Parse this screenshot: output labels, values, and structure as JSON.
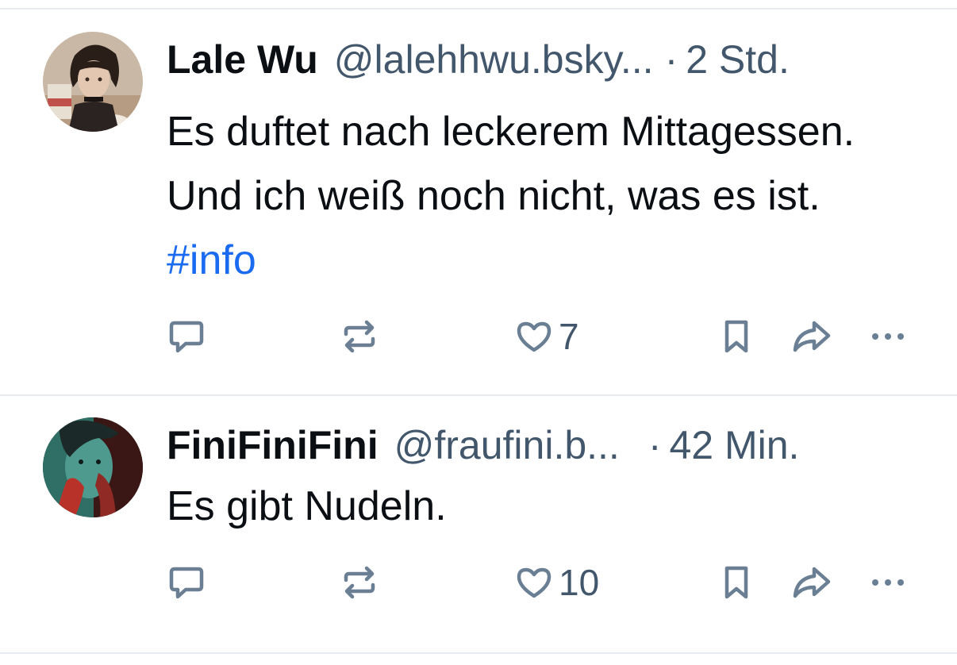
{
  "posts": [
    {
      "display_name": "Lale Wu",
      "handle": "@lalehhwu.bsky...",
      "separator": "·",
      "time": "2 Std.",
      "text": "Es duftet nach leckerem Mittagessen. Und ich weiß noch nicht, was es ist.",
      "hashtag": "#info",
      "like_count": "7",
      "avatar_icon": "avatar-illustration-girl-bob-haircut"
    },
    {
      "display_name": "FiniFiniFini",
      "handle": "@fraufini.b...",
      "separator": "·",
      "time": "42 Min.",
      "text": "Es gibt Nudeln.",
      "like_count": "10",
      "avatar_icon": "avatar-photo-red-teal"
    }
  ],
  "icons": {
    "reply": "speech-bubble-icon",
    "repost": "repost-arrows-icon",
    "like": "heart-icon",
    "bookmark": "bookmark-icon",
    "share": "share-arrow-icon",
    "more": "ellipsis-icon"
  },
  "colors": {
    "text": "#0b0f14",
    "muted": "#42576c",
    "icon": "#6b7f94",
    "hashtag": "#1a6bf0",
    "divider": "#e8ebef"
  }
}
